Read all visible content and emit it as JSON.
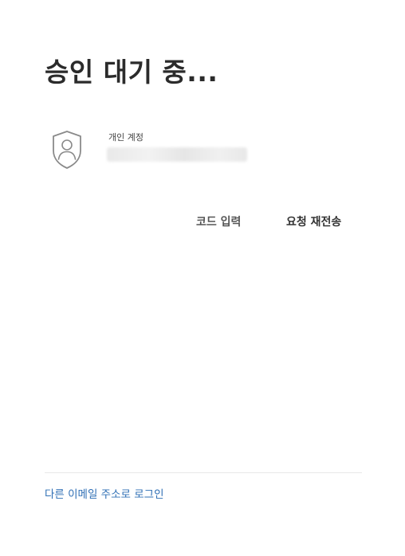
{
  "header": {
    "title": "승인 대기 중..."
  },
  "account": {
    "label": "개인 계정",
    "email": "",
    "icon": "shield-user-icon"
  },
  "actions": {
    "enter_code_label": "코드 입력",
    "resend_label": "요청 재전송"
  },
  "footer": {
    "other_email_link": "다른 이메일 주소로 로그인"
  },
  "colors": {
    "title": "#2b2b2b",
    "link": "#2f6fb5",
    "divider": "#e8e8e8"
  }
}
